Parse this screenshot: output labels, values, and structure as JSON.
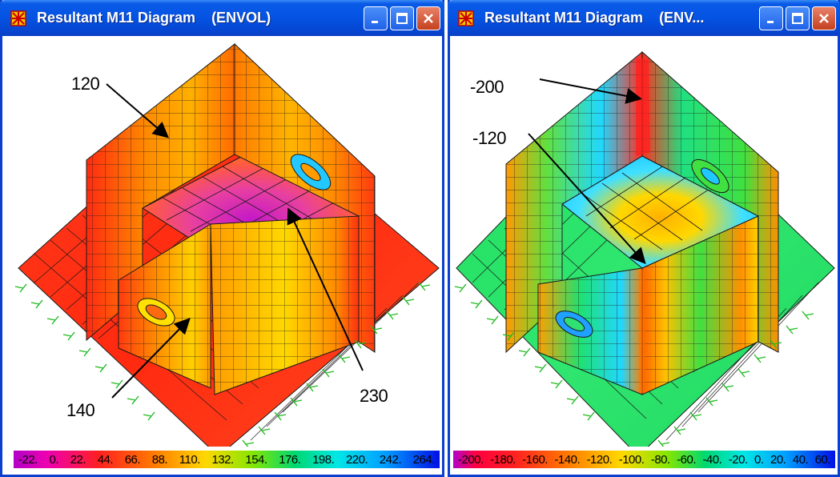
{
  "windows": [
    {
      "title": "Resultant M11 Diagram    (ENVOL)",
      "callouts": [
        "120",
        "230",
        "140"
      ],
      "legend": [
        "-22.",
        "0.",
        "22.",
        "44.",
        "66.",
        "88.",
        "110.",
        "132.",
        "154.",
        "176.",
        "198.",
        "220.",
        "242.",
        "264."
      ]
    },
    {
      "title": "Resultant M11 Diagram    (ENV...",
      "callouts": [
        "-200",
        "-120"
      ],
      "legend": [
        "-200.",
        "-180.",
        "-160.",
        "-140.",
        "-120.",
        "-100.",
        "-80.",
        "-60.",
        "-40.",
        "-20.",
        "0.",
        "20.",
        "40.",
        "60."
      ]
    }
  ],
  "icons": {
    "app": "frame-app-icon",
    "minimize": "minimize-icon",
    "maximize": "maximize-icon",
    "close": "close-icon"
  },
  "colors": {
    "titlebar": "#0554e3",
    "window_border": "#0a3fd0",
    "mesh_line": "#1a1a1a",
    "support": "#22bb22"
  }
}
